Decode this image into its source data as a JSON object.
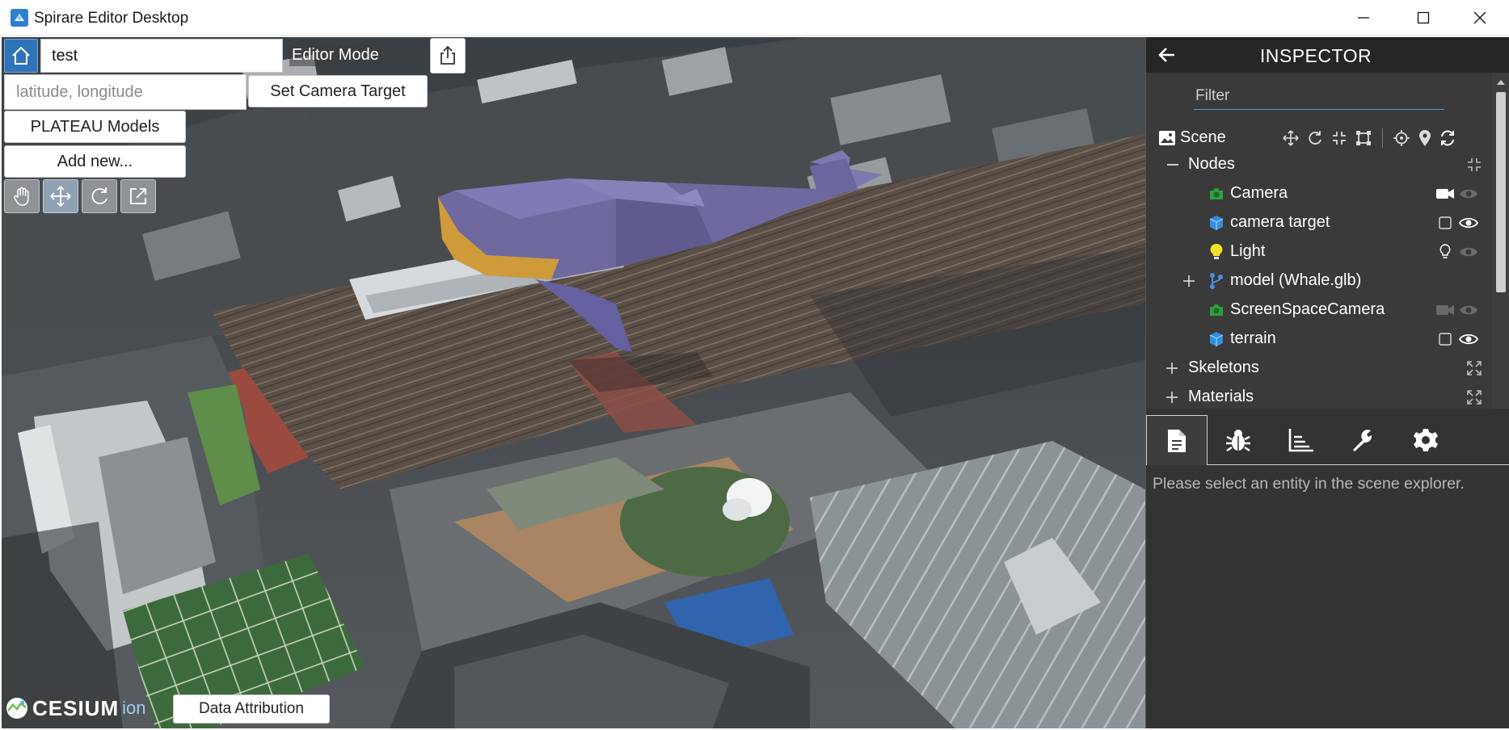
{
  "window": {
    "title": "Spirare Editor Desktop"
  },
  "toolbar": {
    "scene_name": "test",
    "editor_mode_label": "Editor Mode",
    "latlon_placeholder": "latitude, longitude",
    "set_camera_target_label": "Set Camera Target",
    "plateau_models_label": "PLATEAU Models",
    "add_new_label": "Add new...",
    "tools": [
      "hand-icon",
      "move-icon",
      "rotate-icon",
      "scale-icon"
    ]
  },
  "footer": {
    "cesium_logo_text": "CESIUM",
    "cesium_ion_text": "ion",
    "data_attribution_label": "Data Attribution"
  },
  "inspector": {
    "title": "INSPECTOR",
    "filter_placeholder": "Filter",
    "scene_label": "Scene",
    "nodes_label": "Nodes",
    "nodes": [
      {
        "label": "Camera",
        "icon": "camera-icon",
        "icon_color": "#2e9e3c"
      },
      {
        "label": "camera target",
        "icon": "cube-icon",
        "icon_color": "#2f8fe0"
      },
      {
        "label": "Light",
        "icon": "lightbulb-icon",
        "icon_color": "#f2e12b"
      },
      {
        "label": "model (Whale.glb)",
        "icon": "branch-icon",
        "icon_color": "#4a8fe0"
      },
      {
        "label": "ScreenSpaceCamera",
        "icon": "camera-icon",
        "icon_color": "#2e9e3c"
      },
      {
        "label": "terrain",
        "icon": "cube-icon",
        "icon_color": "#2f8fe0"
      }
    ],
    "skeletons_label": "Skeletons",
    "materials_label": "Materials",
    "tabs": [
      "document-icon",
      "bug-icon",
      "chart-icon",
      "wrench-icon",
      "gear-icon"
    ],
    "empty_message": "Please select an entity in the scene explorer."
  },
  "colors": {
    "accent": "#2f74b9",
    "panel_bg": "#333333"
  }
}
